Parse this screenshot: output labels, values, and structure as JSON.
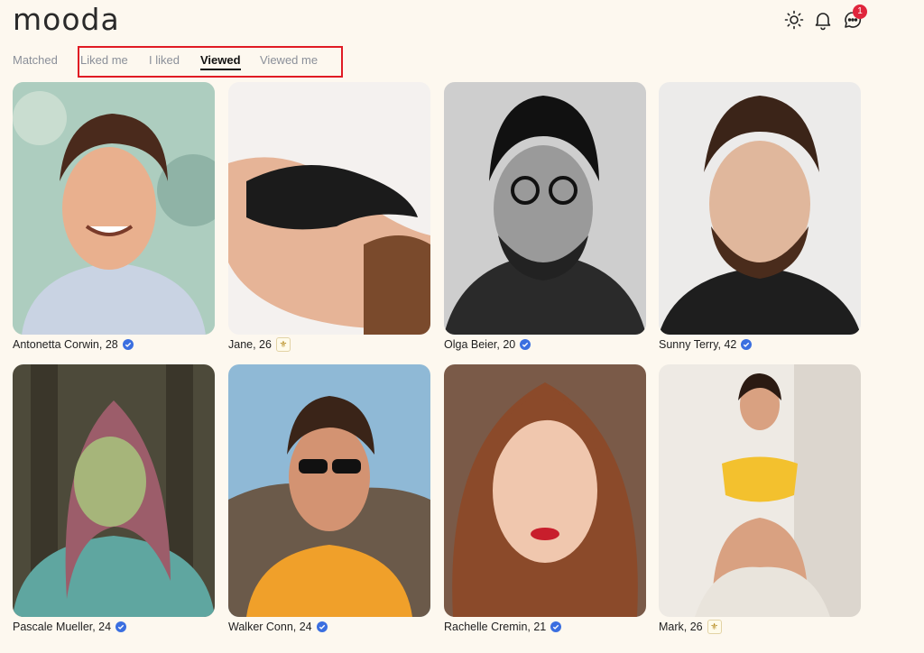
{
  "app": {
    "logo": "mooda"
  },
  "header": {
    "notifications_badge": "1"
  },
  "tabs": [
    {
      "label": "Matched",
      "active": false
    },
    {
      "label": "Liked me",
      "active": false
    },
    {
      "label": "I liked",
      "active": false
    },
    {
      "label": "Viewed",
      "active": true
    },
    {
      "label": "Viewed me",
      "active": false
    }
  ],
  "profiles": [
    {
      "caption": "Antonetta Corwin, 28",
      "badge": "verified"
    },
    {
      "caption": "Jane, 26",
      "badge": "gold"
    },
    {
      "caption": "Olga Beier, 20",
      "badge": "verified"
    },
    {
      "caption": "Sunny Terry, 42",
      "badge": "verified"
    },
    {
      "caption": "Pascale Mueller, 24",
      "badge": "verified"
    },
    {
      "caption": "Walker Conn, 24",
      "badge": "verified"
    },
    {
      "caption": "Rachelle Cremin, 21",
      "badge": "verified"
    },
    {
      "caption": "Mark, 26",
      "badge": "gold"
    }
  ],
  "colors": {
    "background": "#fdf8ef",
    "accent": "#3b6fe0",
    "badge": "#e0263c",
    "highlight": "#e01b24"
  }
}
